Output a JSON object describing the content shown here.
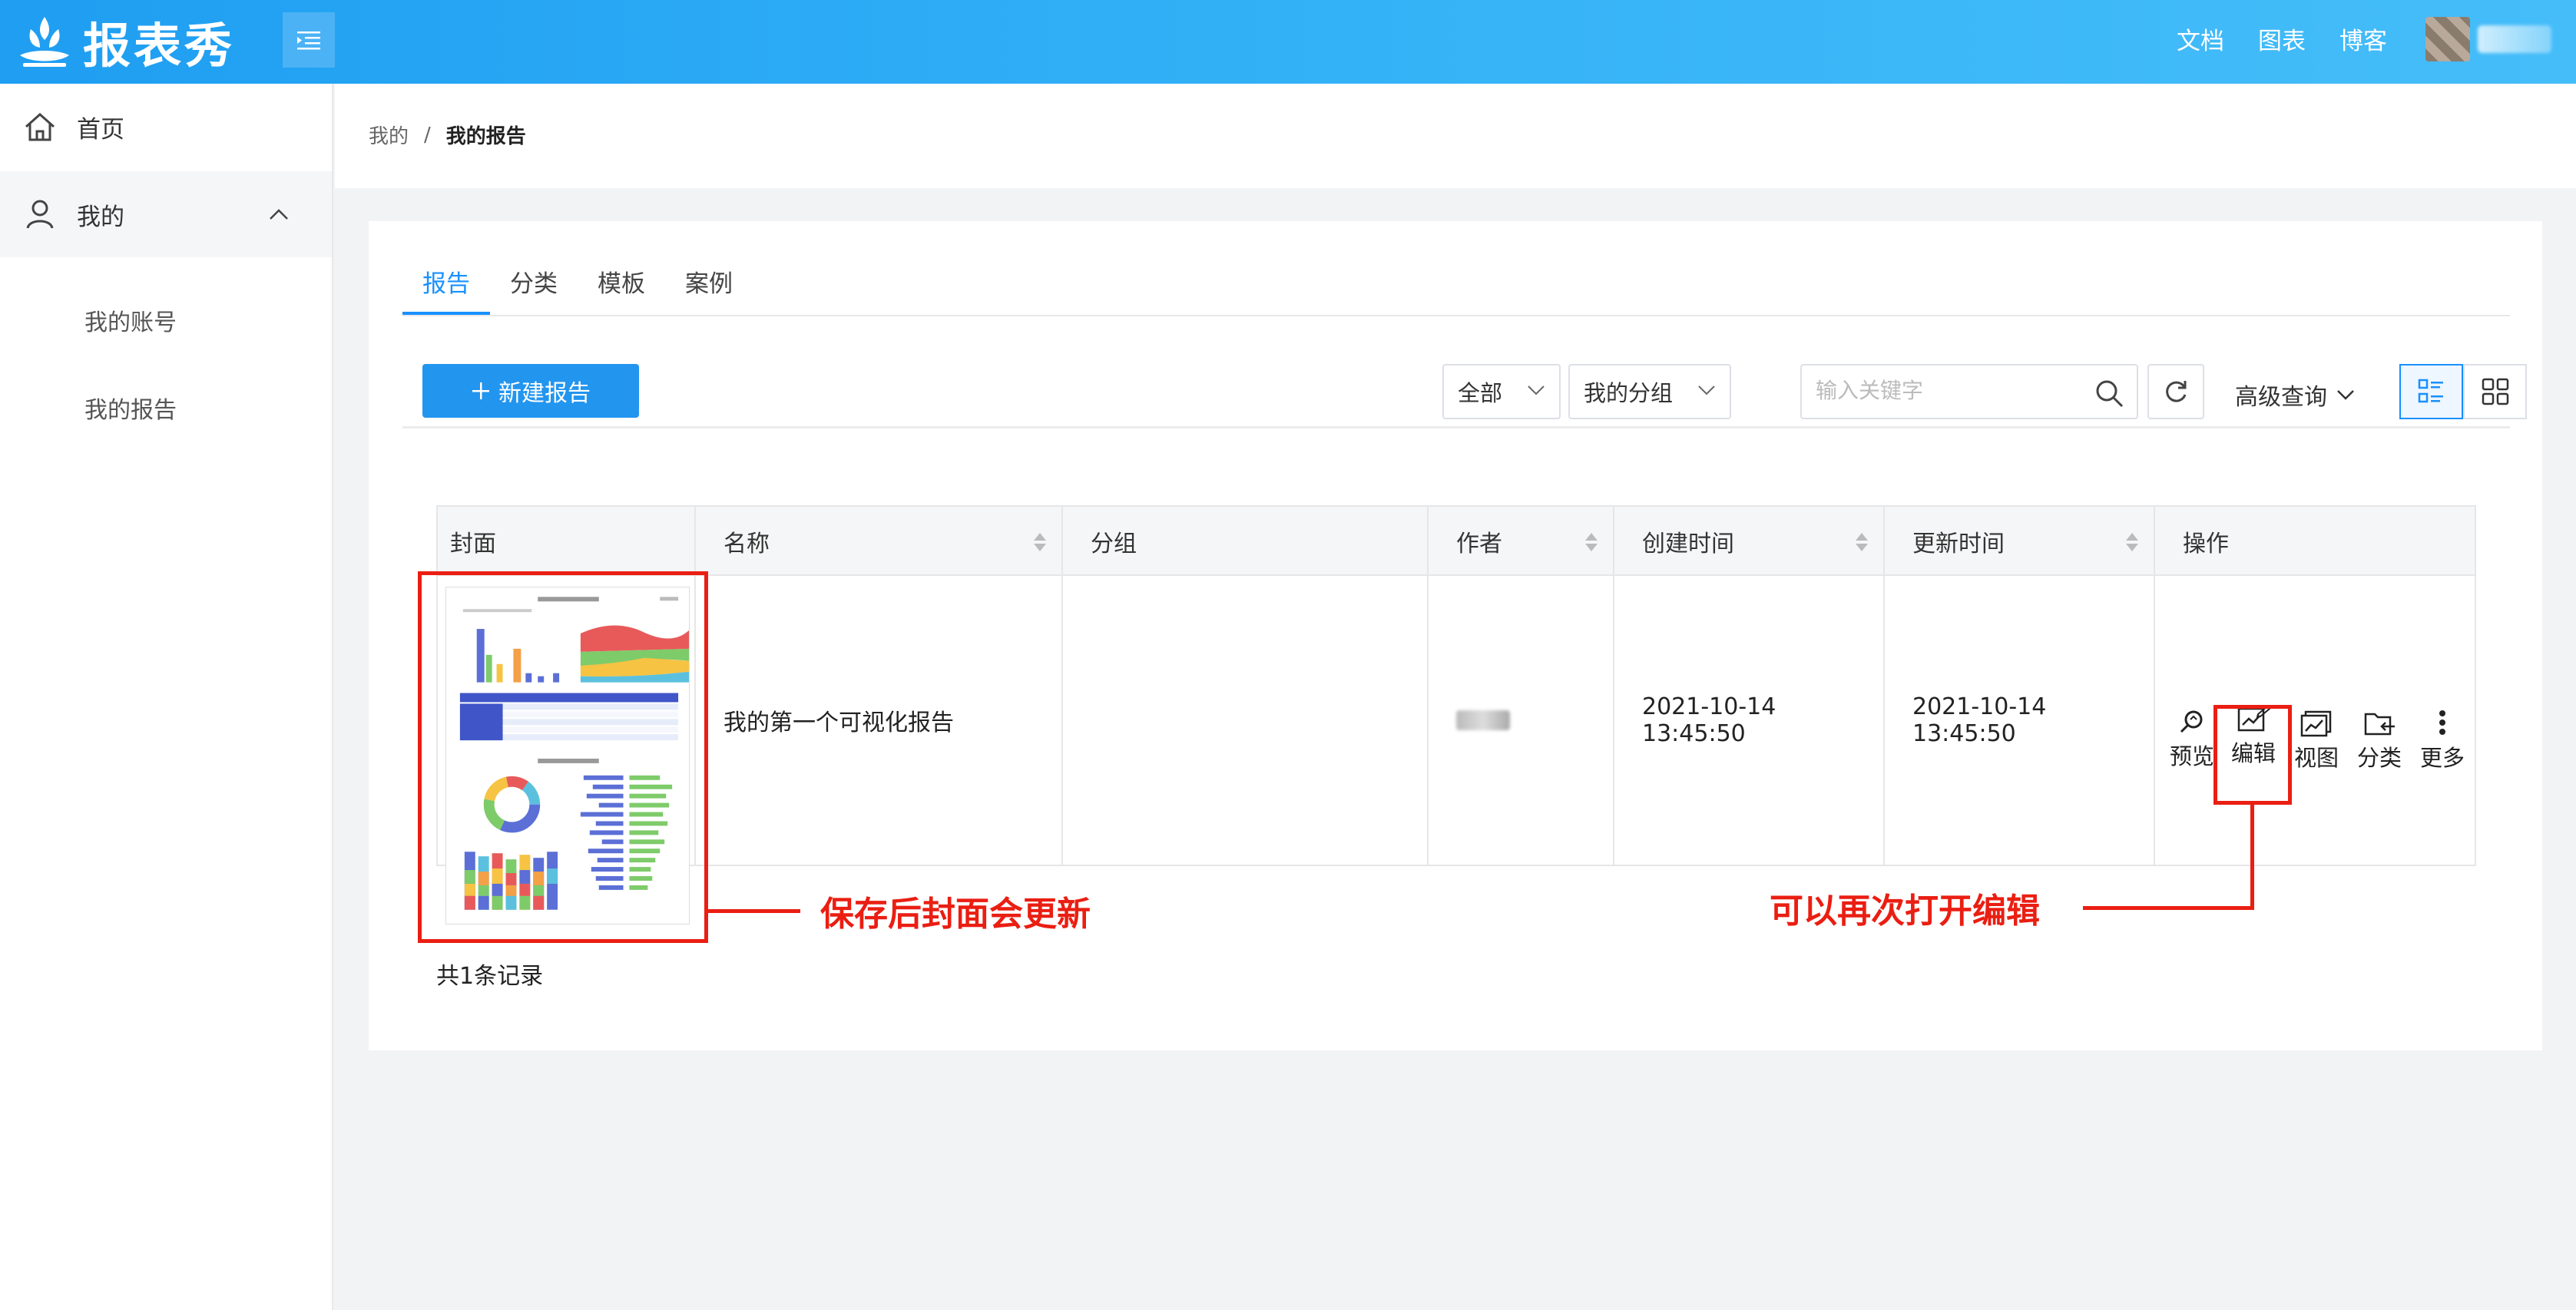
{
  "brand": {
    "name": "报表秀"
  },
  "topnav": {
    "items": [
      "文档",
      "图表",
      "博客"
    ]
  },
  "sidebar": {
    "home": "首页",
    "mine": "我的",
    "sub_items": [
      "我的账号",
      "我的报告"
    ]
  },
  "breadcrumb": {
    "parent": "我的",
    "separator": "/",
    "current": "我的报告"
  },
  "tabs": [
    "报告",
    "分类",
    "模板",
    "案例"
  ],
  "toolbar": {
    "new_button": "新建报告",
    "filter_all": "全部",
    "filter_group": "我的分组",
    "search_placeholder": "输入关键字",
    "advanced_query": "高级查询"
  },
  "table": {
    "columns": [
      "封面",
      "名称",
      "分组",
      "作者",
      "创建时间",
      "更新时间",
      "操作"
    ],
    "rows": [
      {
        "name": "我的第一个可视化报告",
        "group": "",
        "created": "2021-10-14 13:45:50",
        "updated": "2021-10-14 13:45:50"
      }
    ],
    "actions": [
      "预览",
      "编辑",
      "视图",
      "分类",
      "更多"
    ],
    "total": "共1条记录"
  },
  "annotations": {
    "cover_note": "保存后封面会更新",
    "edit_note": "可以再次打开编辑"
  },
  "colors": {
    "primary": "#1890ff",
    "header": "#2fa9f5",
    "annotation": "#ea1e12"
  }
}
